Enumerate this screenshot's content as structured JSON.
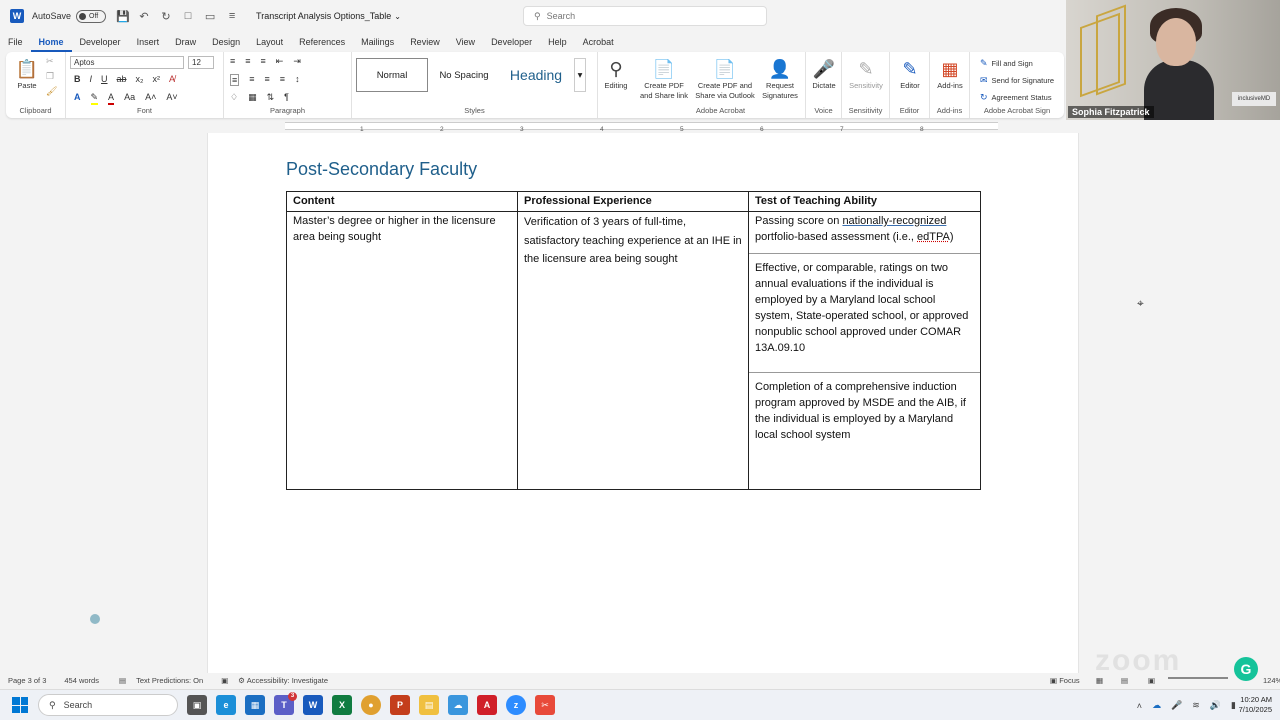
{
  "titlebar": {
    "autosave_label": "AutoSave",
    "autosave_state": "Off",
    "doc_title": "Transcript Analysis Options_Table",
    "search_placeholder": "Search"
  },
  "menu": {
    "tabs": [
      "File",
      "Home",
      "Developer",
      "Insert",
      "Draw",
      "Design",
      "Layout",
      "References",
      "Mailings",
      "Review",
      "View",
      "Developer",
      "Help",
      "Acrobat"
    ],
    "active": "Home"
  },
  "ribbon": {
    "clipboard": {
      "paste": "Paste",
      "label": "Clipboard"
    },
    "font": {
      "name": "Aptos",
      "size": "12",
      "label": "Font"
    },
    "paragraph": {
      "label": "Paragraph"
    },
    "styles": {
      "normal": "Normal",
      "no_spacing": "No Spacing",
      "heading": "Heading",
      "label": "Styles"
    },
    "editing": {
      "label": "Editing"
    },
    "adobe": {
      "create_share": "Create PDF and Share link",
      "create_outlook": "Create PDF and Share via Outlook",
      "request": "Request Signatures",
      "label": "Adobe Acrobat"
    },
    "voice": {
      "dictate": "Dictate",
      "label": "Voice"
    },
    "sensitivity": {
      "btn": "Sensitivity",
      "label": "Sensitivity"
    },
    "editor": {
      "btn": "Editor",
      "label": "Editor"
    },
    "addins": {
      "btn": "Add-ins",
      "label": "Add-ins"
    },
    "sign": {
      "fill": "Fill and Sign",
      "send": "Send for Signature",
      "status": "Agreement Status",
      "label": "Adobe Acrobat Sign"
    }
  },
  "ruler": {
    "numbers": [
      "1",
      "2",
      "3",
      "4",
      "5",
      "6",
      "7",
      "8"
    ]
  },
  "document": {
    "heading": "Post-Secondary Faculty",
    "table": {
      "headers": [
        "Content",
        "Professional Experience",
        "Test of Teaching Ability"
      ],
      "content": "Master’s degree or higher in the licensure area being sought",
      "experience": "Verification of 3 years of full-time, satisfactory teaching experience at an IHE in the licensure area being sought",
      "tt1_pre": "Passing score on ",
      "tt1_link": "nationally-recognized",
      "tt1_mid": " portfolio-based assessment (i.e., ",
      "tt1_err": "edTPA",
      "tt1_post": ")",
      "tt2": "Effective, or comparable, ratings on two annual evaluations if the individual is employed by a Maryland local school system, State-operated school, or approved nonpublic school approved under COMAR 13A.09.10",
      "tt3": "Completion of a comprehensive induction program approved by MSDE and the AIB, if the individual is employed by a Maryland local school system"
    }
  },
  "video": {
    "participant": "Sophia Fitzpatrick",
    "sign_text": "inclusiveMD"
  },
  "status": {
    "page": "Page 3 of 3",
    "words": "454 words",
    "predictions": "Text Predictions: On",
    "accessibility": "Accessibility: Investigate",
    "focus": "Focus",
    "zoom": "124%"
  },
  "taskbar": {
    "search": "Search",
    "time": "10:20 AM",
    "date": "7/10/2025",
    "teams_badge": "3"
  },
  "colors": {
    "word_blue": "#185abd",
    "heading_blue": "#1f5f8b",
    "grammarly": "#15c39a"
  }
}
